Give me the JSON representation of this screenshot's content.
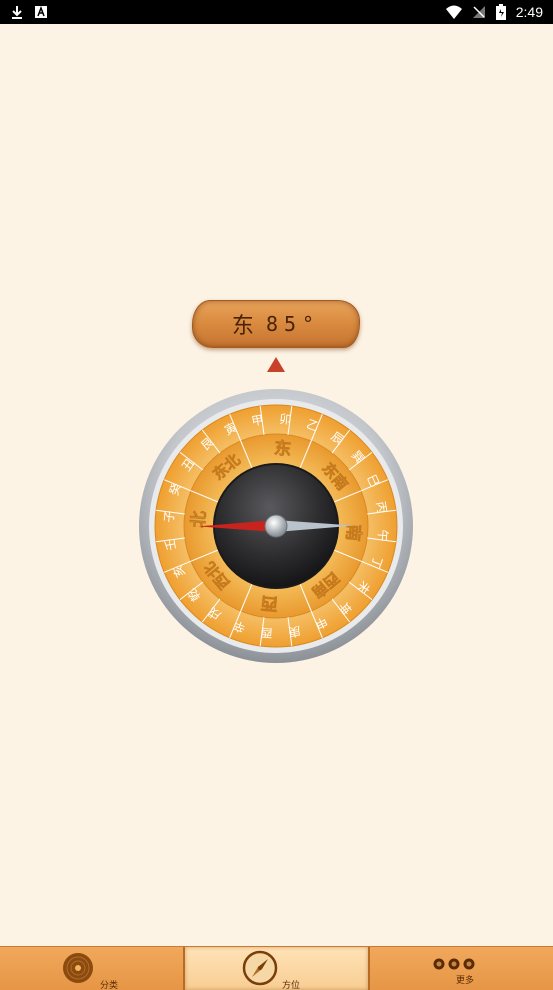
{
  "status_bar": {
    "time": "2:49",
    "left_icons": [
      "download-icon",
      "app-notification-icon"
    ],
    "right_icons": [
      "wifi-icon",
      "no-signal-icon",
      "battery-icon"
    ]
  },
  "heading": {
    "direction": "东",
    "degrees": "85°"
  },
  "compass": {
    "cardinal_labels": [
      "东",
      "东南",
      "南",
      "西南",
      "西",
      "西北",
      "北",
      "东北"
    ],
    "outer_ring_labels": [
      "甲",
      "卯",
      "乙",
      "辰",
      "巽",
      "巳",
      "丙",
      "午",
      "丁",
      "未",
      "坤",
      "申",
      "庚",
      "酉",
      "辛",
      "戌",
      "乾",
      "亥",
      "壬",
      "子",
      "癸",
      "丑",
      "艮",
      "寅"
    ],
    "colors": {
      "ring_gold": "#f3b44a",
      "ring_light": "#f8cf7c",
      "bezel": "#c9ccd1",
      "dial_dark": "#2b2b2e",
      "needle_red": "#c8231c",
      "needle_silver": "#b9c3cc"
    },
    "needle_angle_deg": 85
  },
  "bottom_nav": {
    "items": [
      {
        "label": "分类",
        "icon": "record-disc-icon",
        "active": false
      },
      {
        "label": "方位",
        "icon": "compass-icon",
        "active": true
      },
      {
        "label": "更多",
        "icon": "dots-icon",
        "active": false
      }
    ]
  }
}
